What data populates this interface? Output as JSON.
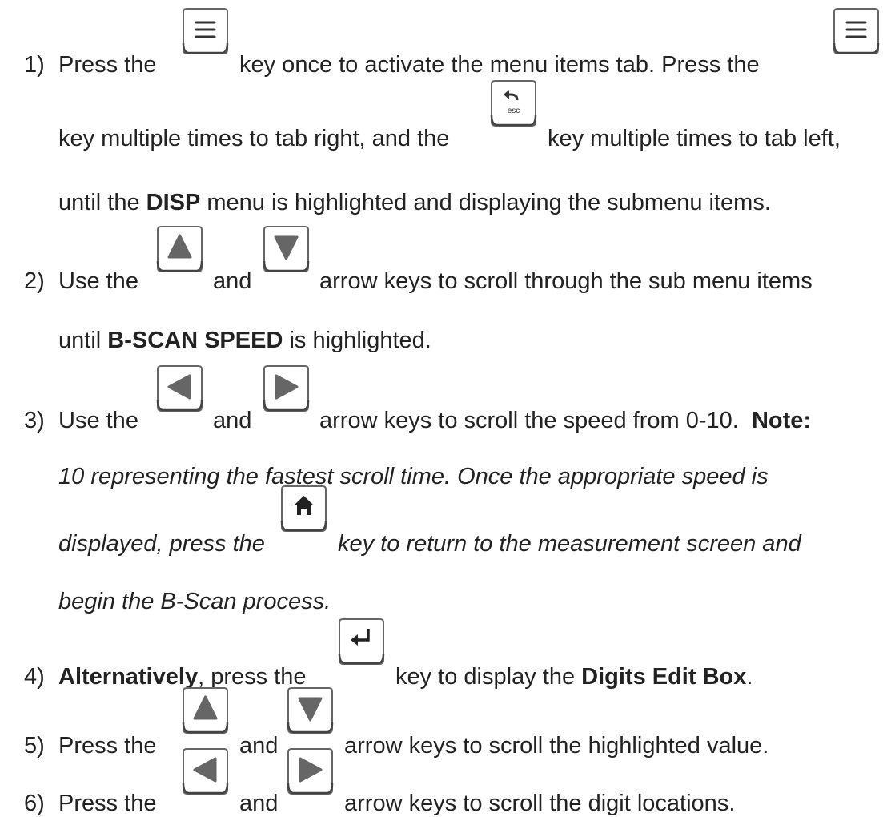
{
  "steps": [
    {
      "number": "1)",
      "l1a": "Press the",
      "l1b": "key once to activate the menu items tab.  Press the",
      "l2a": "key multiple times to tab right, and the",
      "l2b": "key multiple times to tab left,",
      "l3a": "until the",
      "l3b": "DISP",
      "l3c": "menu is highlighted and displaying the submenu items."
    },
    {
      "number": "2)",
      "l1a": "Use the",
      "l1b": "and",
      "l1c": "arrow keys to scroll through the sub menu items",
      "l2a": "until",
      "l2b": "B-SCAN SPEED",
      "l2c": "is highlighted."
    },
    {
      "number": "3)",
      "l1a": "Use the",
      "l1b": "and",
      "l1c": "arrow keys to scroll the speed from 0-10.",
      "l1d": "Note:",
      "l2": "10 representing the fastest scroll time.  Once the appropriate speed is",
      "l3a": "displayed, press the",
      "l3b": "key to return to the measurement screen and",
      "l4": "begin the B-Scan process."
    },
    {
      "number": "4)",
      "a": "Alternatively",
      "b": ", press the",
      "c": "key to display the",
      "d": "Digits Edit Box",
      "e": "."
    },
    {
      "number": "5)",
      "a": "Press the",
      "b": "and",
      "c": "arrow keys to scroll the highlighted value."
    },
    {
      "number": "6)",
      "a": "Press the",
      "b": "and",
      "c": "arrow keys to scroll the digit locations."
    }
  ],
  "keys": {
    "menu": "menu-icon",
    "esc_label": "esc",
    "up": "up-arrow-icon",
    "down": "down-arrow-icon",
    "left": "left-arrow-icon",
    "right": "right-arrow-icon",
    "home": "home-icon",
    "enter": "enter-icon"
  }
}
